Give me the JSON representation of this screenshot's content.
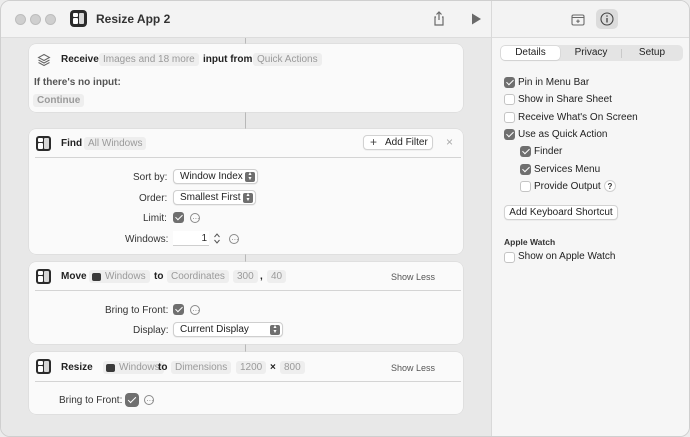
{
  "window": {
    "title": "Resize App 2"
  },
  "receive": {
    "label": "Receive",
    "types": "Images and 18 more",
    "input_from": "input from",
    "source": "Quick Actions",
    "no_input_label": "If there's no input:",
    "no_input_action": "Continue"
  },
  "find": {
    "label": "Find",
    "target": "All Windows",
    "add_filter": "Add Filter",
    "plus": "+",
    "close": "×",
    "sort_label": "Sort by:",
    "sort_value": "Window Index",
    "order_label": "Order:",
    "order_value": "Smallest First",
    "limit_label": "Limit:",
    "windows_label": "Windows:",
    "windows_value": "1"
  },
  "move": {
    "label": "Move",
    "target": "Windows",
    "to": "to",
    "mode": "Coordinates",
    "x": "300",
    "comma": ",",
    "y": "40",
    "show_less": "Show Less",
    "front_label": "Bring to Front:",
    "display_label": "Display:",
    "display_value": "Current Display"
  },
  "resize": {
    "label": "Resize",
    "target": "Windows",
    "to": "to",
    "mode": "Dimensions",
    "w": "1200",
    "times": "×",
    "h": "800",
    "show_less": "Show Less",
    "front_label": "Bring to Front:"
  },
  "panel": {
    "tabs": [
      "Details",
      "Privacy",
      "Setup"
    ],
    "options": [
      {
        "label": "Pin in Menu Bar",
        "checked": true
      },
      {
        "label": "Show in Share Sheet",
        "checked": false
      },
      {
        "label": "Receive What's On Screen",
        "checked": false
      },
      {
        "label": "Use as Quick Action",
        "checked": true
      },
      {
        "label": "Finder",
        "checked": true
      },
      {
        "label": "Services Menu",
        "checked": true
      },
      {
        "label": "Provide Output",
        "checked": false
      }
    ],
    "help": "?",
    "add_shortcut": "Add Keyboard Shortcut",
    "watch_section": "Apple Watch",
    "watch_option": "Show on Apple Watch"
  }
}
